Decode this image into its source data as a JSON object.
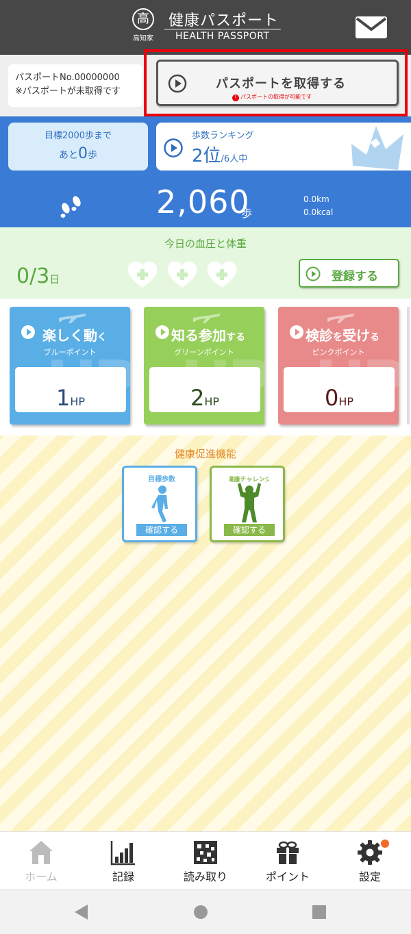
{
  "header": {
    "logo_kanji": "高",
    "logo_sub": "高知家",
    "title": "健康パスポート",
    "subtitle": "HEALTH PASSPORT"
  },
  "passport": {
    "number": "パスポートNo.00000000",
    "status": "※パスポートが未取得です",
    "get_button": "パスポートを取得する",
    "get_note": "パスポートの取得が可能です",
    "note_mark": "!"
  },
  "goal": {
    "line1": "目標2000歩まで",
    "prefix": "あと",
    "remaining": "0",
    "unit": "歩"
  },
  "ranking": {
    "title": "歩数ランキング",
    "rank": "2位",
    "total": "/6人中"
  },
  "activity": {
    "steps": "2,060",
    "steps_unit": "歩",
    "distance": "0.0km",
    "calories": "0.0kcal"
  },
  "bp": {
    "title": "今日の血圧と体重",
    "count": "0/3",
    "count_unit": "日",
    "hearts_total": 3,
    "register": "登録する"
  },
  "cards": [
    {
      "title_a": "楽しく動",
      "title_b": "く",
      "sub": "ブルーポイント",
      "value": "1",
      "unit": "HP",
      "color": "#5aaee6",
      "value_color": "#2a4a7a"
    },
    {
      "title_a": "知る",
      "title_b": "参加",
      "title_c": "する",
      "sub": "グリーンポイント",
      "value": "2",
      "unit": "HP",
      "color": "#96cf5a",
      "value_color": "#2f4a1a"
    },
    {
      "title_a": "検診",
      "title_b": "を",
      "title_c": "受け",
      "title_d": "る",
      "sub": "ピンクポイント",
      "value": "0",
      "unit": "HP",
      "color": "#e88a8a",
      "value_color": "#5a1a1a"
    }
  ],
  "promotion": {
    "title": "健康促進機能",
    "items": [
      {
        "label": "目標歩数",
        "button": "確認する",
        "color": "#5aaee6"
      },
      {
        "label": "健康チャレンジ",
        "button": "確認する",
        "color": "#8ab84a"
      }
    ]
  },
  "nav": {
    "items": [
      {
        "label": "ホーム",
        "icon": "home-icon",
        "active": true
      },
      {
        "label": "記録",
        "icon": "chart-icon"
      },
      {
        "label": "読み取り",
        "icon": "qr-icon"
      },
      {
        "label": "ポイント",
        "icon": "gift-icon"
      },
      {
        "label": "設定",
        "icon": "gear-icon",
        "badge": true
      }
    ]
  },
  "colors": {
    "header": "#474747",
    "blue": "#3a7bd5",
    "green": "#5aa841",
    "alert": "#e8000b",
    "orange": "#e38a2d"
  }
}
